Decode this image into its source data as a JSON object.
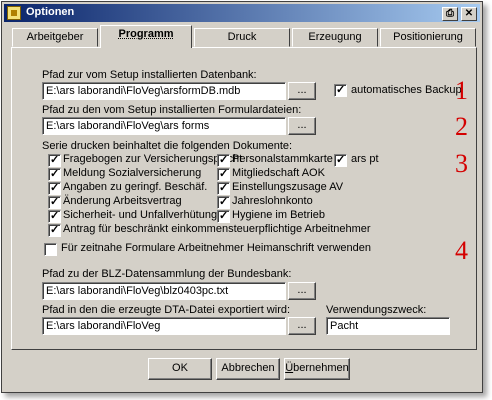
{
  "window": {
    "title": "Optionen",
    "icons": {
      "app": "app-icon",
      "print": "print-icon",
      "close": "close-icon"
    },
    "close_glyph": "✕",
    "print_glyph": "⎙"
  },
  "tabs": [
    {
      "label": "Arbeitgeber"
    },
    {
      "label": "Programm",
      "active": true
    },
    {
      "label": "Druck"
    },
    {
      "label": "Erzeugung"
    },
    {
      "label": "Positionierung"
    }
  ],
  "database": {
    "label": "Pfad zur vom Setup installierten Datenbank:",
    "value": "E:\\ars laborandi\\FloVeg\\arsformDB.mdb",
    "browse": "...",
    "backup_label": "automatisches Backup",
    "backup_checked": true
  },
  "forms": {
    "label": "Pfad zu den vom Setup installierten Formulardateien:",
    "value": "E:\\ars laborandi\\FloVeg\\ars forms",
    "browse": "..."
  },
  "documents": {
    "label": "Serie drucken beinhaltet die folgenden Dokumente:",
    "col1": [
      {
        "label": "Fragebogen zur Versicherungspflicht",
        "checked": true
      },
      {
        "label": "Meldung Sozialversicherung",
        "checked": true
      },
      {
        "label": "Angaben zu geringf. Beschäf.",
        "checked": true
      },
      {
        "label": "Änderung Arbeitsvertrag",
        "checked": true
      },
      {
        "label": "Sicherheit- und Unfallverhütung",
        "checked": true
      },
      {
        "label": "Antrag für beschränkt einkommensteuerpflichtige Arbeitnehmer",
        "checked": true
      }
    ],
    "col2": [
      {
        "label": "Personalstammkarte",
        "checked": true
      },
      {
        "label": "Mitgliedschaft AOK",
        "checked": true
      },
      {
        "label": "Einstellungszusage AV",
        "checked": true
      },
      {
        "label": "Jahreslohnkonto",
        "checked": true
      },
      {
        "label": "Hygiene im Betrieb",
        "checked": true
      }
    ],
    "col3": [
      {
        "label": "ars pt",
        "checked": true
      }
    ]
  },
  "heimanschrift": {
    "label": "Für zeitnahe Formulare Arbeitnehmer Heimanschrift verwenden",
    "checked": false
  },
  "blz": {
    "label": "Pfad zu der BLZ-Datensammlung der Bundesbank:",
    "value": "E:\\ars laborandi\\FloVeg\\blz0403pc.txt",
    "browse": "..."
  },
  "dta": {
    "label": "Pfad in den die erzeugte DTA-Datei exportiert wird:",
    "value": "E:\\ars laborandi\\FloVeg",
    "browse": "...",
    "purpose_label": "Verwendungszweck:",
    "purpose_value": "Pacht"
  },
  "annotations": [
    "1",
    "2",
    "3",
    "4"
  ],
  "annotation_color": "#d40000",
  "buttons": {
    "ok": "OK",
    "cancel": "Abbrechen",
    "apply_first": "Ü",
    "apply_rest": "bernehmen"
  }
}
